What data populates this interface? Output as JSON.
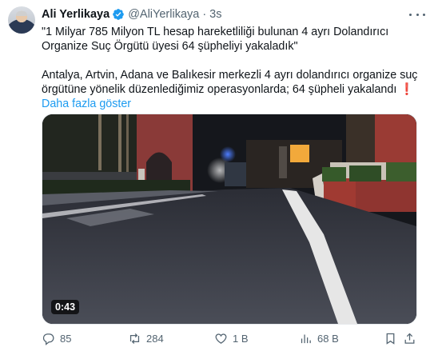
{
  "author": {
    "name": "Ali Yerlikaya",
    "handle": "@AliYerlikaya",
    "separator": "·",
    "time": "3s"
  },
  "tweet": {
    "line1": "\"1 Milyar 785 Milyon TL hesap hareketliliği bulunan 4 ayrı Dolandırıcı Organize Suç Örgütü üyesi 64 şüpheliyi yakaladık\"",
    "line2": "Antalya, Artvin, Adana ve Balıkesir merkezli 4 ayrı dolandırıcı organize suç örgütüne yönelik düzenlediğimiz operasyonlarda; 64 şüpheli yakalandı ❗",
    "show_more": "Daha fazla göster"
  },
  "media": {
    "duration": "0:43",
    "sign_text": "..."
  },
  "actions": {
    "replies": "85",
    "retweets": "284",
    "likes": "1 B",
    "views": "68 B"
  },
  "icons": {
    "verified": "verified-badge-icon",
    "more": "more-icon",
    "reply": "reply-icon",
    "retweet": "retweet-icon",
    "like": "heart-icon",
    "views": "views-icon",
    "bookmark": "bookmark-icon",
    "share": "share-icon"
  },
  "colors": {
    "accent": "#1d9bf0",
    "verified": "#1d9bf0",
    "text": "#0f1419",
    "muted": "#536471"
  }
}
